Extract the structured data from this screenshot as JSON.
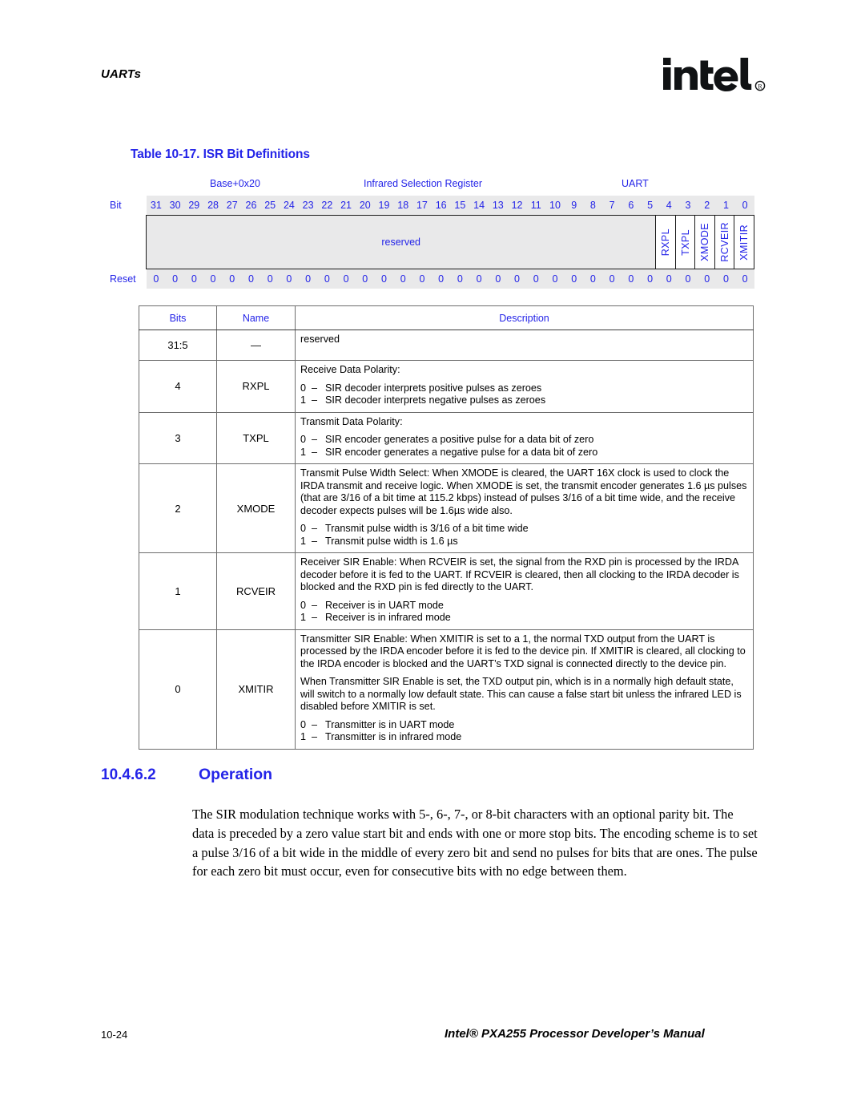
{
  "running_head": "UARTs",
  "logo": {
    "wordmark": "intel",
    "registered_mark": "®"
  },
  "table_caption": "Table 10-17. ISR Bit Definitions",
  "register_diagram": {
    "address": "Base+0x20",
    "register_name": "Infrared Selection Register",
    "unit": "UART",
    "bit_row_label": "Bit",
    "reset_row_label": "Reset",
    "bits": [
      "31",
      "30",
      "29",
      "28",
      "27",
      "26",
      "25",
      "24",
      "23",
      "22",
      "21",
      "20",
      "19",
      "18",
      "17",
      "16",
      "15",
      "14",
      "13",
      "12",
      "11",
      "10",
      "9",
      "8",
      "7",
      "6",
      "5",
      "4",
      "3",
      "2",
      "1",
      "0"
    ],
    "reset_values": [
      "0",
      "0",
      "0",
      "0",
      "0",
      "0",
      "0",
      "0",
      "0",
      "0",
      "0",
      "0",
      "0",
      "0",
      "0",
      "0",
      "0",
      "0",
      "0",
      "0",
      "0",
      "0",
      "0",
      "0",
      "0",
      "0",
      "0",
      "0",
      "0",
      "0",
      "0",
      "0"
    ],
    "reserved_label": "reserved",
    "fields": [
      {
        "label": "RXPL",
        "bit": "4"
      },
      {
        "label": "TXPL",
        "bit": "3"
      },
      {
        "label": "XMODE",
        "bit": "2"
      },
      {
        "label": "RCVEIR",
        "bit": "1"
      },
      {
        "label": "XMITIR",
        "bit": "0"
      }
    ]
  },
  "bit_table": {
    "headers": {
      "bits": "Bits",
      "name": "Name",
      "description": "Description"
    },
    "rows": [
      {
        "bits": "31:5",
        "name": "—",
        "paragraphs": [
          "reserved"
        ],
        "options": []
      },
      {
        "bits": "4",
        "name": "RXPL",
        "paragraphs": [
          "Receive Data Polarity:"
        ],
        "options": [
          {
            "value": "0",
            "dash": "–",
            "text": "SIR decoder interprets positive pulses as zeroes"
          },
          {
            "value": "1",
            "dash": "–",
            "text": "SIR decoder interprets negative pulses as zeroes"
          }
        ]
      },
      {
        "bits": "3",
        "name": "TXPL",
        "paragraphs": [
          "Transmit Data Polarity:"
        ],
        "options": [
          {
            "value": "0",
            "dash": "–",
            "text": "SIR encoder generates a positive pulse for a data bit of zero"
          },
          {
            "value": "1",
            "dash": "–",
            "text": "SIR encoder generates a negative pulse for a data bit of zero"
          }
        ]
      },
      {
        "bits": "2",
        "name": "XMODE",
        "paragraphs": [
          "Transmit Pulse Width Select: When XMODE is cleared, the UART 16X clock is used to clock the IRDA transmit and receive logic. When XMODE is set, the transmit encoder generates 1.6 µs pulses (that are 3/16 of a bit time at 115.2 kbps) instead of pulses 3/16 of a bit time wide, and the receive decoder expects pulses will be 1.6µs wide also."
        ],
        "options": [
          {
            "value": "0",
            "dash": "–",
            "text": "Transmit pulse width is 3/16 of a bit time wide"
          },
          {
            "value": "1",
            "dash": "–",
            "text": "Transmit pulse width is 1.6 µs"
          }
        ]
      },
      {
        "bits": "1",
        "name": "RCVEIR",
        "paragraphs": [
          "Receiver SIR Enable: When RCVEIR is set, the signal from the RXD pin is processed by the IRDA decoder before it is fed to the UART. If RCVEIR is cleared, then all clocking to the IRDA decoder is blocked and the RXD pin is fed directly to the UART."
        ],
        "options": [
          {
            "value": "0",
            "dash": "–",
            "text": "Receiver is in UART mode"
          },
          {
            "value": "1",
            "dash": "–",
            "text": "Receiver is in infrared mode"
          }
        ]
      },
      {
        "bits": "0",
        "name": "XMITIR",
        "paragraphs": [
          "Transmitter SIR Enable: When XMITIR is set to a 1, the normal TXD output from the UART is processed by the IRDA encoder before it is fed to the device pin. If XMITIR is cleared, all clocking to the IRDA encoder is blocked and the UART’s TXD signal is connected directly to the device pin.",
          "When Transmitter SIR Enable is set, the TXD output pin, which is in a normally high default state, will switch to a normally low default state. This can cause a false start bit unless the infrared LED is disabled before XMITIR is set."
        ],
        "options": [
          {
            "value": "0",
            "dash": "–",
            "text": "Transmitter is in UART mode"
          },
          {
            "value": "1",
            "dash": "–",
            "text": "Transmitter is in infrared mode"
          }
        ]
      }
    ]
  },
  "section": {
    "number": "10.4.6.2",
    "title": "Operation",
    "body": "The SIR modulation technique works with 5-, 6-, 7-, or 8-bit characters with an optional parity bit. The data is preceded by a zero value start bit and ends with one or more stop bits. The encoding scheme is to set a pulse 3/16 of a bit wide in the middle of every zero bit and send no pulses for bits that are ones. The pulse for each zero bit must occur, even for consecutive bits with no edge between them."
  },
  "footer": {
    "page_number": "10-24",
    "manual_title": "Intel® PXA255 Processor Developer’s Manual"
  },
  "colors": {
    "accent_blue": "#2424e8",
    "band_gray": "#e9e9ea",
    "rule_gray": "#6d6d6d"
  }
}
